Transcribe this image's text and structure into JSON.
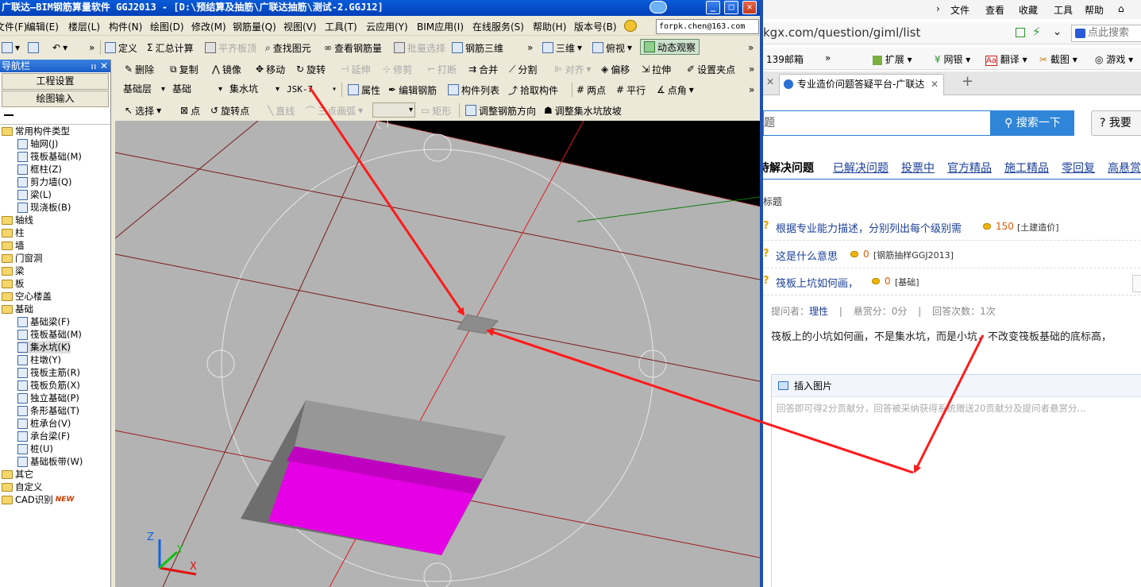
{
  "app": {
    "title": "广联达—BIM钢筋算量软件 GGJ2013 - [D:\\预结算及抽筋\\广联达抽筋\\测试-2.GGJ12]",
    "account": "forpk.chen@163.com",
    "menus": [
      "文件(F)",
      "编辑(E)",
      "楼层(L)",
      "构件(N)",
      "绘图(D)",
      "修改(M)",
      "钢筋量(Q)",
      "视图(V)",
      "工具(T)",
      "云应用(Y)",
      "BIM应用(I)",
      "在线服务(S)",
      "帮助(H)",
      "版本号(B)"
    ],
    "toolbar1": {
      "define": "定义",
      "sum": "汇总计算",
      "align_slab": "平齐板顶",
      "find": "查找图元",
      "view_rebar": "查看钢筋量",
      "batch_select": "批量选择",
      "rebar_3d": "钢筋三维",
      "view_3d": "三维",
      "top_view": "俯视",
      "dynamic_view": "动态观察"
    },
    "toolbar2": {
      "delete": "删除",
      "copy": "复制",
      "mirror": "镜像",
      "move": "移动",
      "rotate": "旋转",
      "extend": "延伸",
      "trim": "修剪",
      "break": "打断",
      "merge": "合并",
      "split": "分割",
      "align": "对齐",
      "offset": "偏移",
      "stretch": "拉伸",
      "set_point": "设置夹点"
    },
    "toolbar3": {
      "layer": "基础层",
      "category": "基础",
      "element_type": "集水坑",
      "element_name": "JSK-7",
      "properties": "属性",
      "edit_rebar": "编辑钢筋",
      "element_list": "构件列表",
      "pick": "拾取构件",
      "two_point": "两点",
      "parallel": "平行",
      "point_angle": "点角"
    },
    "toolbar4": {
      "select": "选择",
      "point": "点",
      "rotate_point": "旋转点",
      "line": "直线",
      "arc": "三点画弧",
      "rect": "矩形",
      "adjust_rebar_dir": "调整钢筋方向",
      "adjust_slope": "调整集水坑放坡"
    }
  },
  "nav": {
    "title": "导航栏",
    "project_settings": "工程设置",
    "drawing_input": "绘图输入",
    "tree": [
      {
        "label": "常用构件类型",
        "level": 0,
        "folder": true,
        "expanded": true
      },
      {
        "label": "轴网(J)",
        "level": 1
      },
      {
        "label": "筏板基础(M)",
        "level": 1
      },
      {
        "label": "框柱(Z)",
        "level": 1
      },
      {
        "label": "剪力墙(Q)",
        "level": 1
      },
      {
        "label": "梁(L)",
        "level": 1
      },
      {
        "label": "现浇板(B)",
        "level": 1
      },
      {
        "label": "轴线",
        "level": 0,
        "folder": true
      },
      {
        "label": "柱",
        "level": 0,
        "folder": true
      },
      {
        "label": "墙",
        "level": 0,
        "folder": true
      },
      {
        "label": "门窗洞",
        "level": 0,
        "folder": true
      },
      {
        "label": "梁",
        "level": 0,
        "folder": true
      },
      {
        "label": "板",
        "level": 0,
        "folder": true
      },
      {
        "label": "空心楼盖",
        "level": 0,
        "folder": true
      },
      {
        "label": "基础",
        "level": 0,
        "folder": true,
        "expanded": true
      },
      {
        "label": "基础梁(F)",
        "level": 1
      },
      {
        "label": "筏板基础(M)",
        "level": 1
      },
      {
        "label": "集水坑(K)",
        "level": 1,
        "selected": true
      },
      {
        "label": "柱墩(Y)",
        "level": 1
      },
      {
        "label": "筏板主筋(R)",
        "level": 1
      },
      {
        "label": "筏板负筋(X)",
        "level": 1
      },
      {
        "label": "独立基础(P)",
        "level": 1
      },
      {
        "label": "条形基础(T)",
        "level": 1
      },
      {
        "label": "桩承台(V)",
        "level": 1
      },
      {
        "label": "承台梁(F)",
        "level": 1
      },
      {
        "label": "桩(U)",
        "level": 1
      },
      {
        "label": "基础板带(W)",
        "level": 1
      },
      {
        "label": "其它",
        "level": 0,
        "folder": true
      },
      {
        "label": "自定义",
        "level": 0,
        "folder": true
      },
      {
        "label": "CAD识别",
        "level": 0,
        "folder": true,
        "badge": "NEW"
      }
    ]
  },
  "viewport": {
    "axis_x": "X",
    "axis_y": "Y",
    "axis_z": "Z",
    "colors": {
      "background": "#b3b3b3",
      "pit": "#e600e6",
      "grid_line": "#8b1a1a",
      "selected_line": "#ff1a1a"
    }
  },
  "browser": {
    "menus": [
      "文件",
      "查看",
      "收藏",
      "工具",
      "帮助"
    ],
    "url": "kgx.com/question/giml/list",
    "search_placeholder": "点此搜索",
    "favorites": [
      "139邮箱",
      "扩展",
      "网银",
      "翻译",
      "截图",
      "游戏"
    ],
    "tab_title": "专业造价问题答疑平台-广联达",
    "page": {
      "search_input": "题",
      "search_button": "搜索一下",
      "ask_button": "我要",
      "tabs": [
        "待解决问题",
        "已解决问题",
        "投票中",
        "官方精品",
        "施工精品",
        "零回复",
        "高悬赏"
      ],
      "column_header": "标题",
      "questions": [
        {
          "title": "根据专业能力描述，分别列出每个级别需",
          "score": "150",
          "category": "[土建造价]"
        },
        {
          "title": "这是什么意思",
          "score": "0",
          "category": "[钢筋抽样GGJ2013]"
        },
        {
          "title": "筏板上坑如何画，",
          "score": "0",
          "category": "[基础]"
        }
      ],
      "meta": {
        "asker_label": "提问者：",
        "asker": "理性",
        "reward": "悬赏分：0分",
        "answers": "回答次数：1次"
      },
      "question_body": "筏板上的小坑如何画，不是集水坑，而是小坑，不改变筏板基础的底标高，",
      "insert_image": "插入图片",
      "answer_placeholder": "回答即可得2分贡献分，回答被采纳获得系统赠送20贡献分及提问者悬赏分..."
    }
  }
}
